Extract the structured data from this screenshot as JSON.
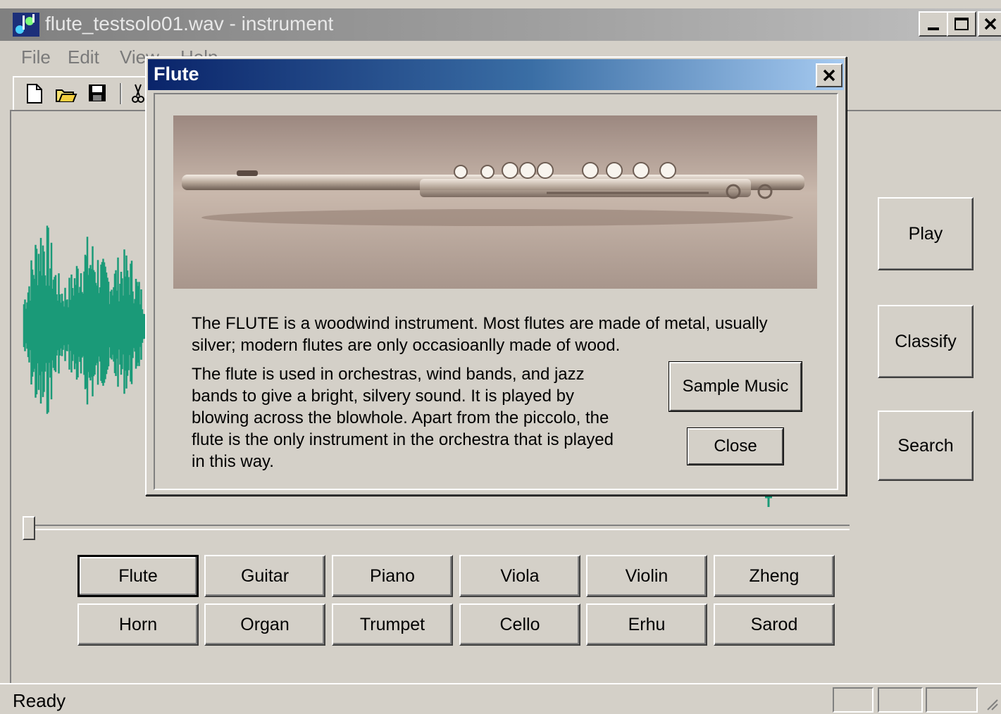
{
  "window": {
    "title": "flute_testsolo01.wav - instrument",
    "minimize_icon": "minimize-icon",
    "maximize_icon": "maximize-icon",
    "close_icon": "close-icon"
  },
  "menu": {
    "items": [
      "File",
      "Edit",
      "View",
      "Help"
    ]
  },
  "toolbar": {
    "icons": [
      "new-file-icon",
      "open-folder-icon",
      "save-icon",
      "cut-icon"
    ]
  },
  "side_buttons": {
    "play": "Play",
    "classify": "Classify",
    "search": "Search"
  },
  "instruments": {
    "row1": [
      "Flute",
      "Guitar",
      "Piano",
      "Viola",
      "Violin",
      "Zheng"
    ],
    "row2": [
      "Horn",
      "Organ",
      "Trumpet",
      "Cello",
      "Erhu",
      "Sarod"
    ],
    "selected": "Flute"
  },
  "dialog": {
    "title": "Flute",
    "description_1": "The FLUTE is a woodwind instrument. Most flutes are made of metal, usually silver; modern flutes are only occasioanlly made of wood.",
    "description_2": "The flute is used in orchestras, wind bands, and jazz bands to give a bright, silvery sound. It is played by blowing across the blowhole. Apart from the piccolo, the flute is the only instrument in the orchestra that is played in this way.",
    "sample_music_button": "Sample Music",
    "close_button": "Close"
  },
  "status": {
    "text": "Ready"
  },
  "colors": {
    "waveform": "#1a9a78",
    "dialog_title_start": "#0a246a",
    "dialog_title_end": "#a6caf0"
  }
}
